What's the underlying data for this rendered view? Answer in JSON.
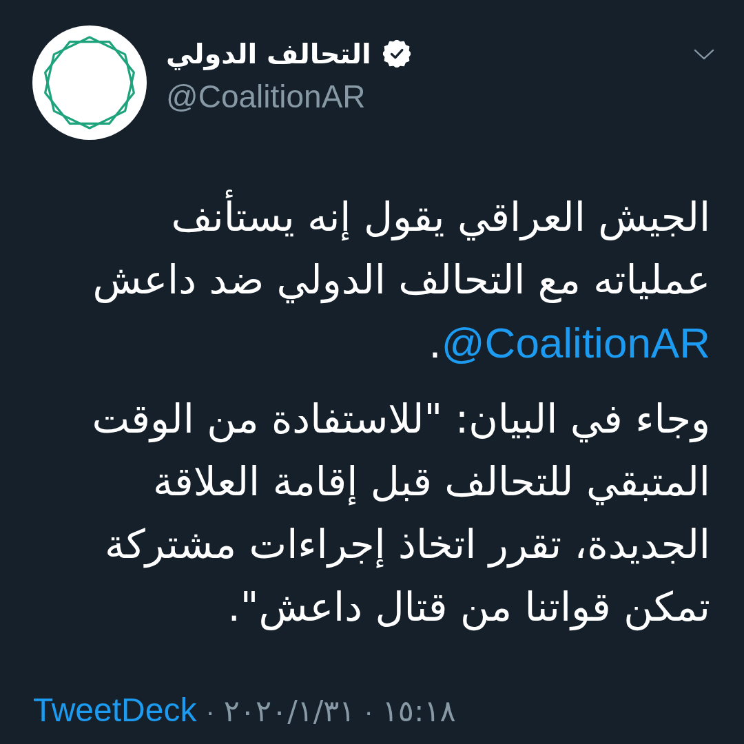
{
  "tweet": {
    "author": {
      "name": "التحالف الدولي",
      "verified": true,
      "handle": "@CoalitionAR"
    },
    "paragraphs": [
      {
        "parts": [
          {
            "kind": "text",
            "text": "الجيش العراقي يقول إنه يستأنف\nعملياته مع التحالف الدولي ضد داعش\n"
          },
          {
            "kind": "mention",
            "text": "@CoalitionAR"
          },
          {
            "kind": "text",
            "text": "."
          }
        ]
      },
      {
        "parts": [
          {
            "kind": "text",
            "text": "وجاء في البيان: \"للاستفادة من الوقت\nالمتبقي للتحالف قبل إقامة العلاقة\nالجديدة، تقرر اتخاذ إجراءات مشتركة\nتمكن قواتنا من قتال داعش\"."
          }
        ]
      }
    ],
    "meta": [
      {
        "kind": "time",
        "text": "١٥:١٨"
      },
      {
        "kind": "separator",
        "text": "·"
      },
      {
        "kind": "date",
        "text": "٢٠٢٠/١/٣١"
      },
      {
        "kind": "separator",
        "text": "·"
      },
      {
        "kind": "source",
        "text": "TweetDeck"
      }
    ]
  }
}
